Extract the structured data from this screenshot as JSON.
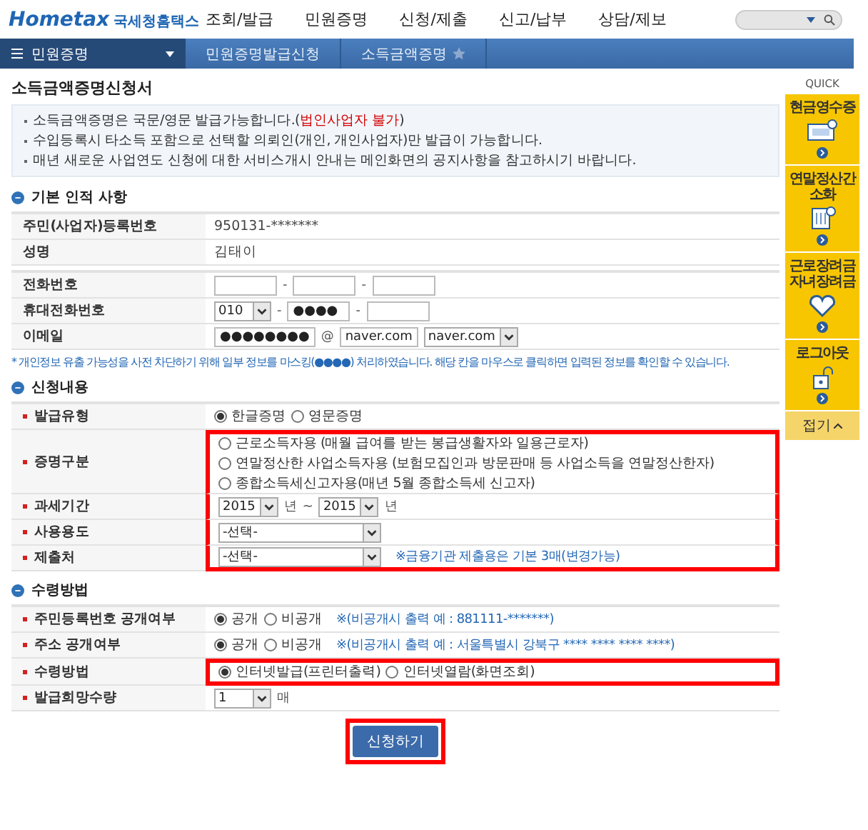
{
  "header": {
    "logo": "Hometax",
    "logo_sub": "국세청홈택스",
    "nav": [
      "조회/발급",
      "민원증명",
      "신청/제출",
      "신고/납부",
      "상담/제보"
    ]
  },
  "breadcrumb": {
    "menu": "민원증명",
    "items": [
      "민원증명발급신청",
      "소득금액증명"
    ]
  },
  "title": "소득금액증명신청서",
  "notices": [
    {
      "text": "소득금액증명은 국문/영문 발급가능합니다.(",
      "highlight": "법인사업자 불가",
      "tail": ")"
    },
    {
      "text": "수입등록시 타소득 포함으로 선택할 의뢰인(개인, 개인사업자)만 발급이 가능합니다."
    },
    {
      "text": "매년 새로운 사업연도 신청에 대한 서비스개시 안내는 메인화면의 공지사항을 참고하시기 바랍니다."
    }
  ],
  "sections": [
    {
      "title": "기본 인적 사항",
      "groups": [
        [
          {
            "label": "주민(사업자)등록번호",
            "required": false,
            "highlighted": false,
            "kind": "text",
            "value": "950131-*******"
          },
          {
            "label": "성명",
            "required": false,
            "highlighted": false,
            "kind": "text",
            "value": "김태이"
          }
        ],
        [
          {
            "label": "전화번호",
            "required": false,
            "highlighted": false,
            "kind": "fields",
            "parts": [
              {
                "kind": "input"
              },
              {
                "kind": "input",
                "prefix": "-"
              },
              {
                "kind": "input",
                "prefix": "-"
              }
            ]
          },
          {
            "label": "휴대전화번호",
            "required": false,
            "highlighted": false,
            "kind": "fields",
            "parts": [
              {
                "kind": "select",
                "value": "010"
              },
              {
                "kind": "input",
                "prefix": "-",
                "value": "●●●●"
              },
              {
                "kind": "input",
                "prefix": "-"
              }
            ]
          },
          {
            "label": "이메일",
            "required": false,
            "highlighted": false,
            "kind": "fields",
            "parts": [
              {
                "kind": "input",
                "value": "●●●●●●●●"
              },
              {
                "kind": "input",
                "prefix": "@",
                "value": "naver.com"
              },
              {
                "kind": "select",
                "value": "naver.com"
              }
            ]
          }
        ]
      ],
      "note": "* 개인정보 유출 가능성을 사전 차단하기 위해 일부 정보를 마스킹(●●●●) 처리하였습니다. 해당 칸을 마우스로 클릭하면 입력된 정보를 확인할 수 있습니다."
    },
    {
      "title": "신청내용",
      "groups": [
        [
          {
            "label": "발급유형",
            "required": true,
            "highlighted": false,
            "kind": "radio",
            "options": [
              {
                "label": "한글증명",
                "selected": true
              },
              {
                "label": "영문증명",
                "selected": false
              }
            ]
          },
          {
            "label": "증명구분",
            "required": true,
            "kind": "radio-list",
            "highlighted": true,
            "options": [
              {
                "label": "근로소득자용 (매월 급여를 받는 봉급생활자와 일용근로자)",
                "selected": false
              },
              {
                "label": "연말정산한 사업소득자용 (보험모집인과 방문판매 등 사업소득을 연말정산한자)",
                "selected": false
              },
              {
                "label": "종합소득세신고자용(매년 5월 종합소득세 신고자)",
                "selected": false
              }
            ]
          },
          {
            "label": "과세기간",
            "required": true,
            "kind": "fields",
            "highlighted": true,
            "parts": [
              {
                "kind": "select",
                "value": "2015",
                "suffix": "년"
              },
              {
                "kind": "select",
                "value": "2015",
                "prefix": "~",
                "suffix": "년"
              }
            ]
          },
          {
            "label": "사용용도",
            "required": true,
            "kind": "fields",
            "highlighted": true,
            "parts": [
              {
                "kind": "wide-select",
                "value": "-선택-"
              }
            ]
          },
          {
            "label": "제출처",
            "required": true,
            "kind": "fields",
            "highlighted": true,
            "parts": [
              {
                "kind": "wide-select",
                "value": "-선택-"
              }
            ],
            "note": "※금융기관 제출용은 기본 3매(변경가능)"
          }
        ]
      ]
    },
    {
      "title": "수령방법",
      "groups": [
        [
          {
            "label": "주민등록번호 공개여부",
            "required": true,
            "highlighted": false,
            "kind": "radio",
            "options": [
              {
                "label": "공개",
                "selected": true
              },
              {
                "label": "비공개",
                "selected": false
              }
            ],
            "note": "※(비공개시 출력 예 : 881111-*******)"
          },
          {
            "label": "주소 공개여부",
            "required": true,
            "highlighted": false,
            "kind": "radio",
            "options": [
              {
                "label": "공개",
                "selected": true
              },
              {
                "label": "비공개",
                "selected": false
              }
            ],
            "note": "※(비공개시 출력 예 : 서울특별시 강북구 **** **** **** ****)"
          },
          {
            "label": "수령방법",
            "required": true,
            "kind": "radio",
            "highlighted": true,
            "options": [
              {
                "label": "인터넷발급(프린터출력)",
                "selected": true
              },
              {
                "label": "인터넷열람(화면조회)",
                "selected": false
              }
            ]
          },
          {
            "label": "발급희망수량",
            "required": true,
            "highlighted": false,
            "kind": "fields",
            "parts": [
              {
                "kind": "select",
                "value": "1",
                "suffix": "매"
              }
            ]
          }
        ]
      ]
    }
  ],
  "submit": {
    "label": "신청하기",
    "highlighted": true
  },
  "quick": {
    "title": "QUICK",
    "items": [
      {
        "label": "현금영수증"
      },
      {
        "label": "연말정산간소화"
      },
      {
        "label": "근로장려금 자녀장려금"
      },
      {
        "label": "로그아웃"
      }
    ],
    "footer": "접기"
  }
}
